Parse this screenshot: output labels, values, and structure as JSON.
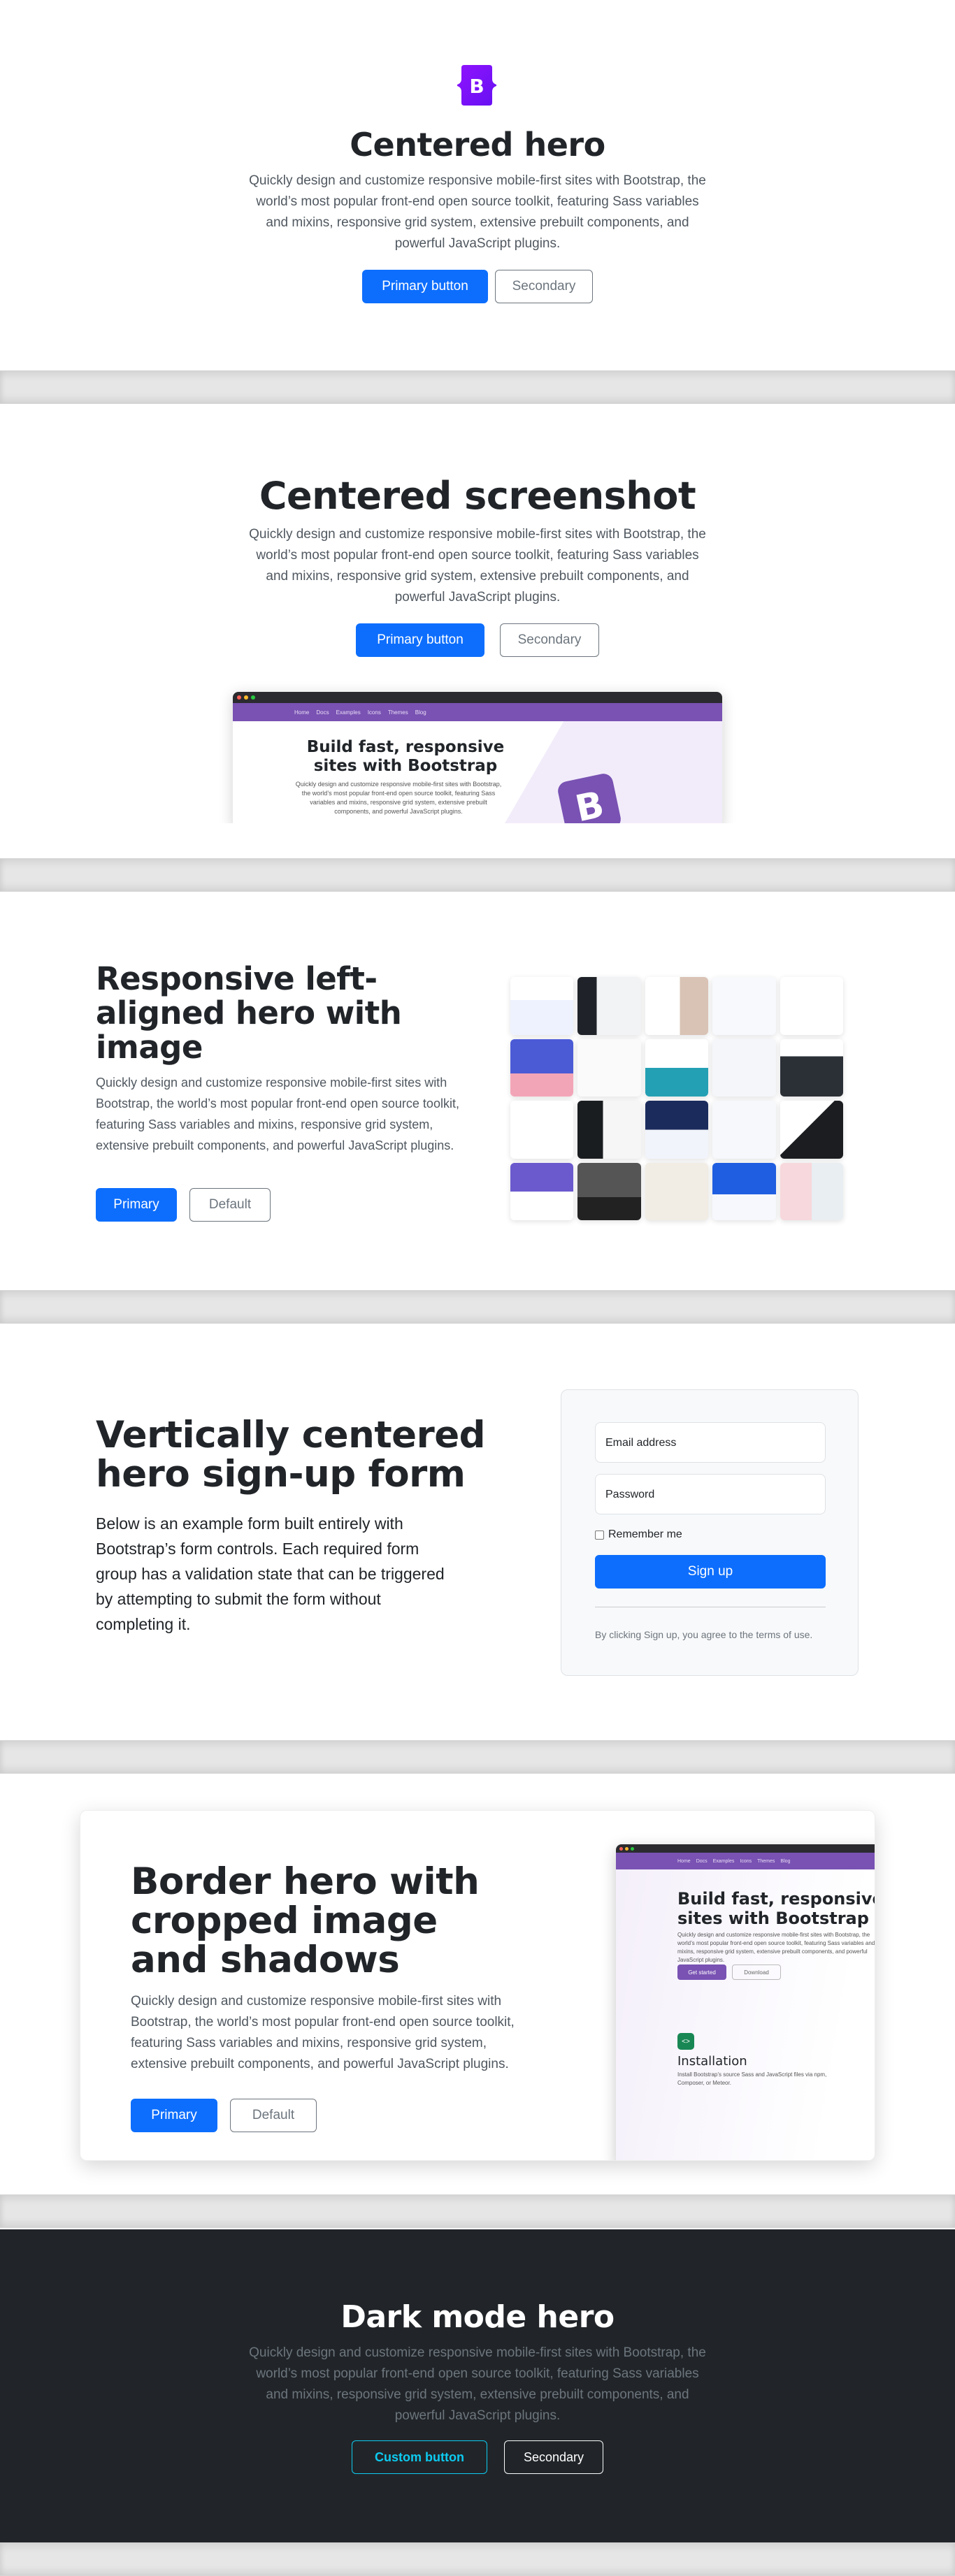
{
  "hero1": {
    "logo_letter": "B",
    "title": "Centered hero",
    "lead": "Quickly design and customize responsive mobile-first sites with Bootstrap, the world’s most popular front-end open source toolkit, featuring Sass variables and mixins, responsive grid system, extensive prebuilt components, and powerful JavaScript plugins.",
    "primary": "Primary button",
    "secondary": "Secondary"
  },
  "hero2": {
    "title": "Centered screenshot",
    "lead": "Quickly design and customize responsive mobile-first sites with Bootstrap, the world’s most popular front-end open source toolkit, featuring Sass variables and mixins, responsive grid system, extensive prebuilt components, and powerful JavaScript plugins.",
    "primary": "Primary button",
    "secondary": "Secondary",
    "screenshot": {
      "nav": [
        "Home",
        "Docs",
        "Examples",
        "Icons",
        "Themes",
        "Blog"
      ],
      "title": "Build fast, responsive sites with Bootstrap",
      "text": "Quickly design and customize responsive mobile-first sites with Bootstrap, the world’s most popular front-end open source toolkit, featuring Sass variables and mixins, responsive grid system, extensive prebuilt components, and powerful JavaScript plugins.",
      "logo_letter": "B"
    }
  },
  "hero3": {
    "title": "Responsive left-aligned hero with image",
    "lead": "Quickly design and customize responsive mobile-first sites with Bootstrap, the world’s most popular front-end open source toolkit, featuring Sass variables and mixins, responsive grid system, extensive prebuilt components, and powerful JavaScript plugins.",
    "primary": "Primary",
    "secondary": "Default"
  },
  "hero4": {
    "title": "Vertically centered hero sign-up form",
    "lead": "Below is an example form built entirely with Bootstrap’s form controls. Each required form group has a validation state that can be triggered by attempting to submit the form without completing it.",
    "email_label": "Email address",
    "password_label": "Password",
    "remember": "Remember me",
    "signup": "Sign up",
    "terms": "By clicking Sign up, you agree to the terms of use."
  },
  "hero5": {
    "title": "Border hero with cropped image and shadows",
    "lead": "Quickly design and customize responsive mobile-first sites with Bootstrap, the world’s most popular front-end open source toolkit, featuring Sass variables and mixins, responsive grid system, extensive prebuilt components, and powerful JavaScript plugins.",
    "primary": "Primary",
    "secondary": "Default",
    "screenshot": {
      "nav": [
        "Home",
        "Docs",
        "Examples",
        "Icons",
        "Themes",
        "Blog"
      ],
      "title": "Build fast, responsive sites with Bootstrap",
      "text": "Quickly design and customize responsive mobile-first sites with Bootstrap, the world’s most popular front-end open source toolkit, featuring Sass variables and mixins, responsive grid system, extensive prebuilt components, and powerful JavaScript plugins.",
      "get_started": "Get started",
      "download": "Download",
      "install_title": "Installation",
      "install_text": "Install Bootstrap’s source Sass and JavaScript files via npm, Composer, or Meteor.",
      "install_icon": "<>"
    }
  },
  "hero6": {
    "title": "Dark mode hero",
    "lead": "Quickly design and customize responsive mobile-first sites with Bootstrap, the world’s most popular front-end open source toolkit, featuring Sass variables and mixins, responsive grid system, extensive prebuilt components, and powerful JavaScript plugins.",
    "primary": "Custom button",
    "secondary": "Secondary"
  },
  "colors": {
    "primary": "#0d6efd",
    "bootstrap_purple": "#7952b3",
    "dark_bg": "#212529",
    "info": "#0dcaf0"
  }
}
